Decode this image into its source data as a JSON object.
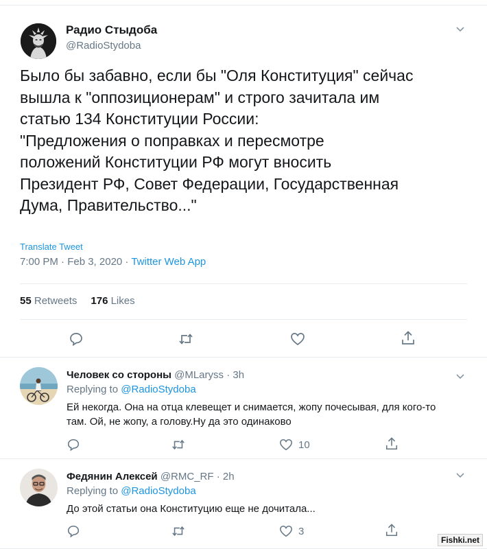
{
  "main_tweet": {
    "author_name": "Радио Стыдоба",
    "author_handle": "@RadioStydoba",
    "text_lines": [
      "Было бы забавно, если бы \"Оля Конституция\" сейчас",
      "вышла к \"оппозиционерам\" и строго зачитала им",
      "статью 134 Конституции России:",
      "\"Предложения о поправках и пересмотре",
      "положений Конституции РФ могут вносить",
      "Президент РФ, Совет Федерации, Государственная",
      "Дума, Правительство...\""
    ],
    "translate_label": "Translate Tweet",
    "time": "7:00 PM · Feb 3, 2020 · ",
    "app": "Twitter Web App",
    "retweets_count": "55",
    "retweets_label": "Retweets",
    "likes_count": "176",
    "likes_label": "Likes",
    "icons": [
      "reply-icon",
      "retweet-icon",
      "like-icon",
      "share-icon",
      "chevron-down-icon"
    ]
  },
  "replies": [
    {
      "author_name": "Человек со стороны",
      "author_handle": "@MLaryss",
      "age": "3h",
      "replying_prefix": "Replying to",
      "replying_to": "@RadioStydoba",
      "text": "Ей некогда. Она на отца клевещет и снимается, жопу почесывая, для кого-то там. Ой, не жопу, а голову.Ну да это одинаково",
      "reply_count": "",
      "retweet_count": "",
      "like_count": "10"
    },
    {
      "author_name": "Федянин Алексей",
      "author_handle": "@RMC_RF",
      "age": "2h",
      "replying_prefix": "Replying to",
      "replying_to": "@RadioStydoba",
      "text": "До этой статьи она Конституцию еще не дочитала...",
      "reply_count": "",
      "retweet_count": "",
      "like_count": "3"
    }
  ],
  "watermark": "Fishki.net",
  "colors": {
    "link": "#1b95e0",
    "muted": "#657786",
    "text": "#14171a",
    "divider": "#e6ecf0"
  }
}
